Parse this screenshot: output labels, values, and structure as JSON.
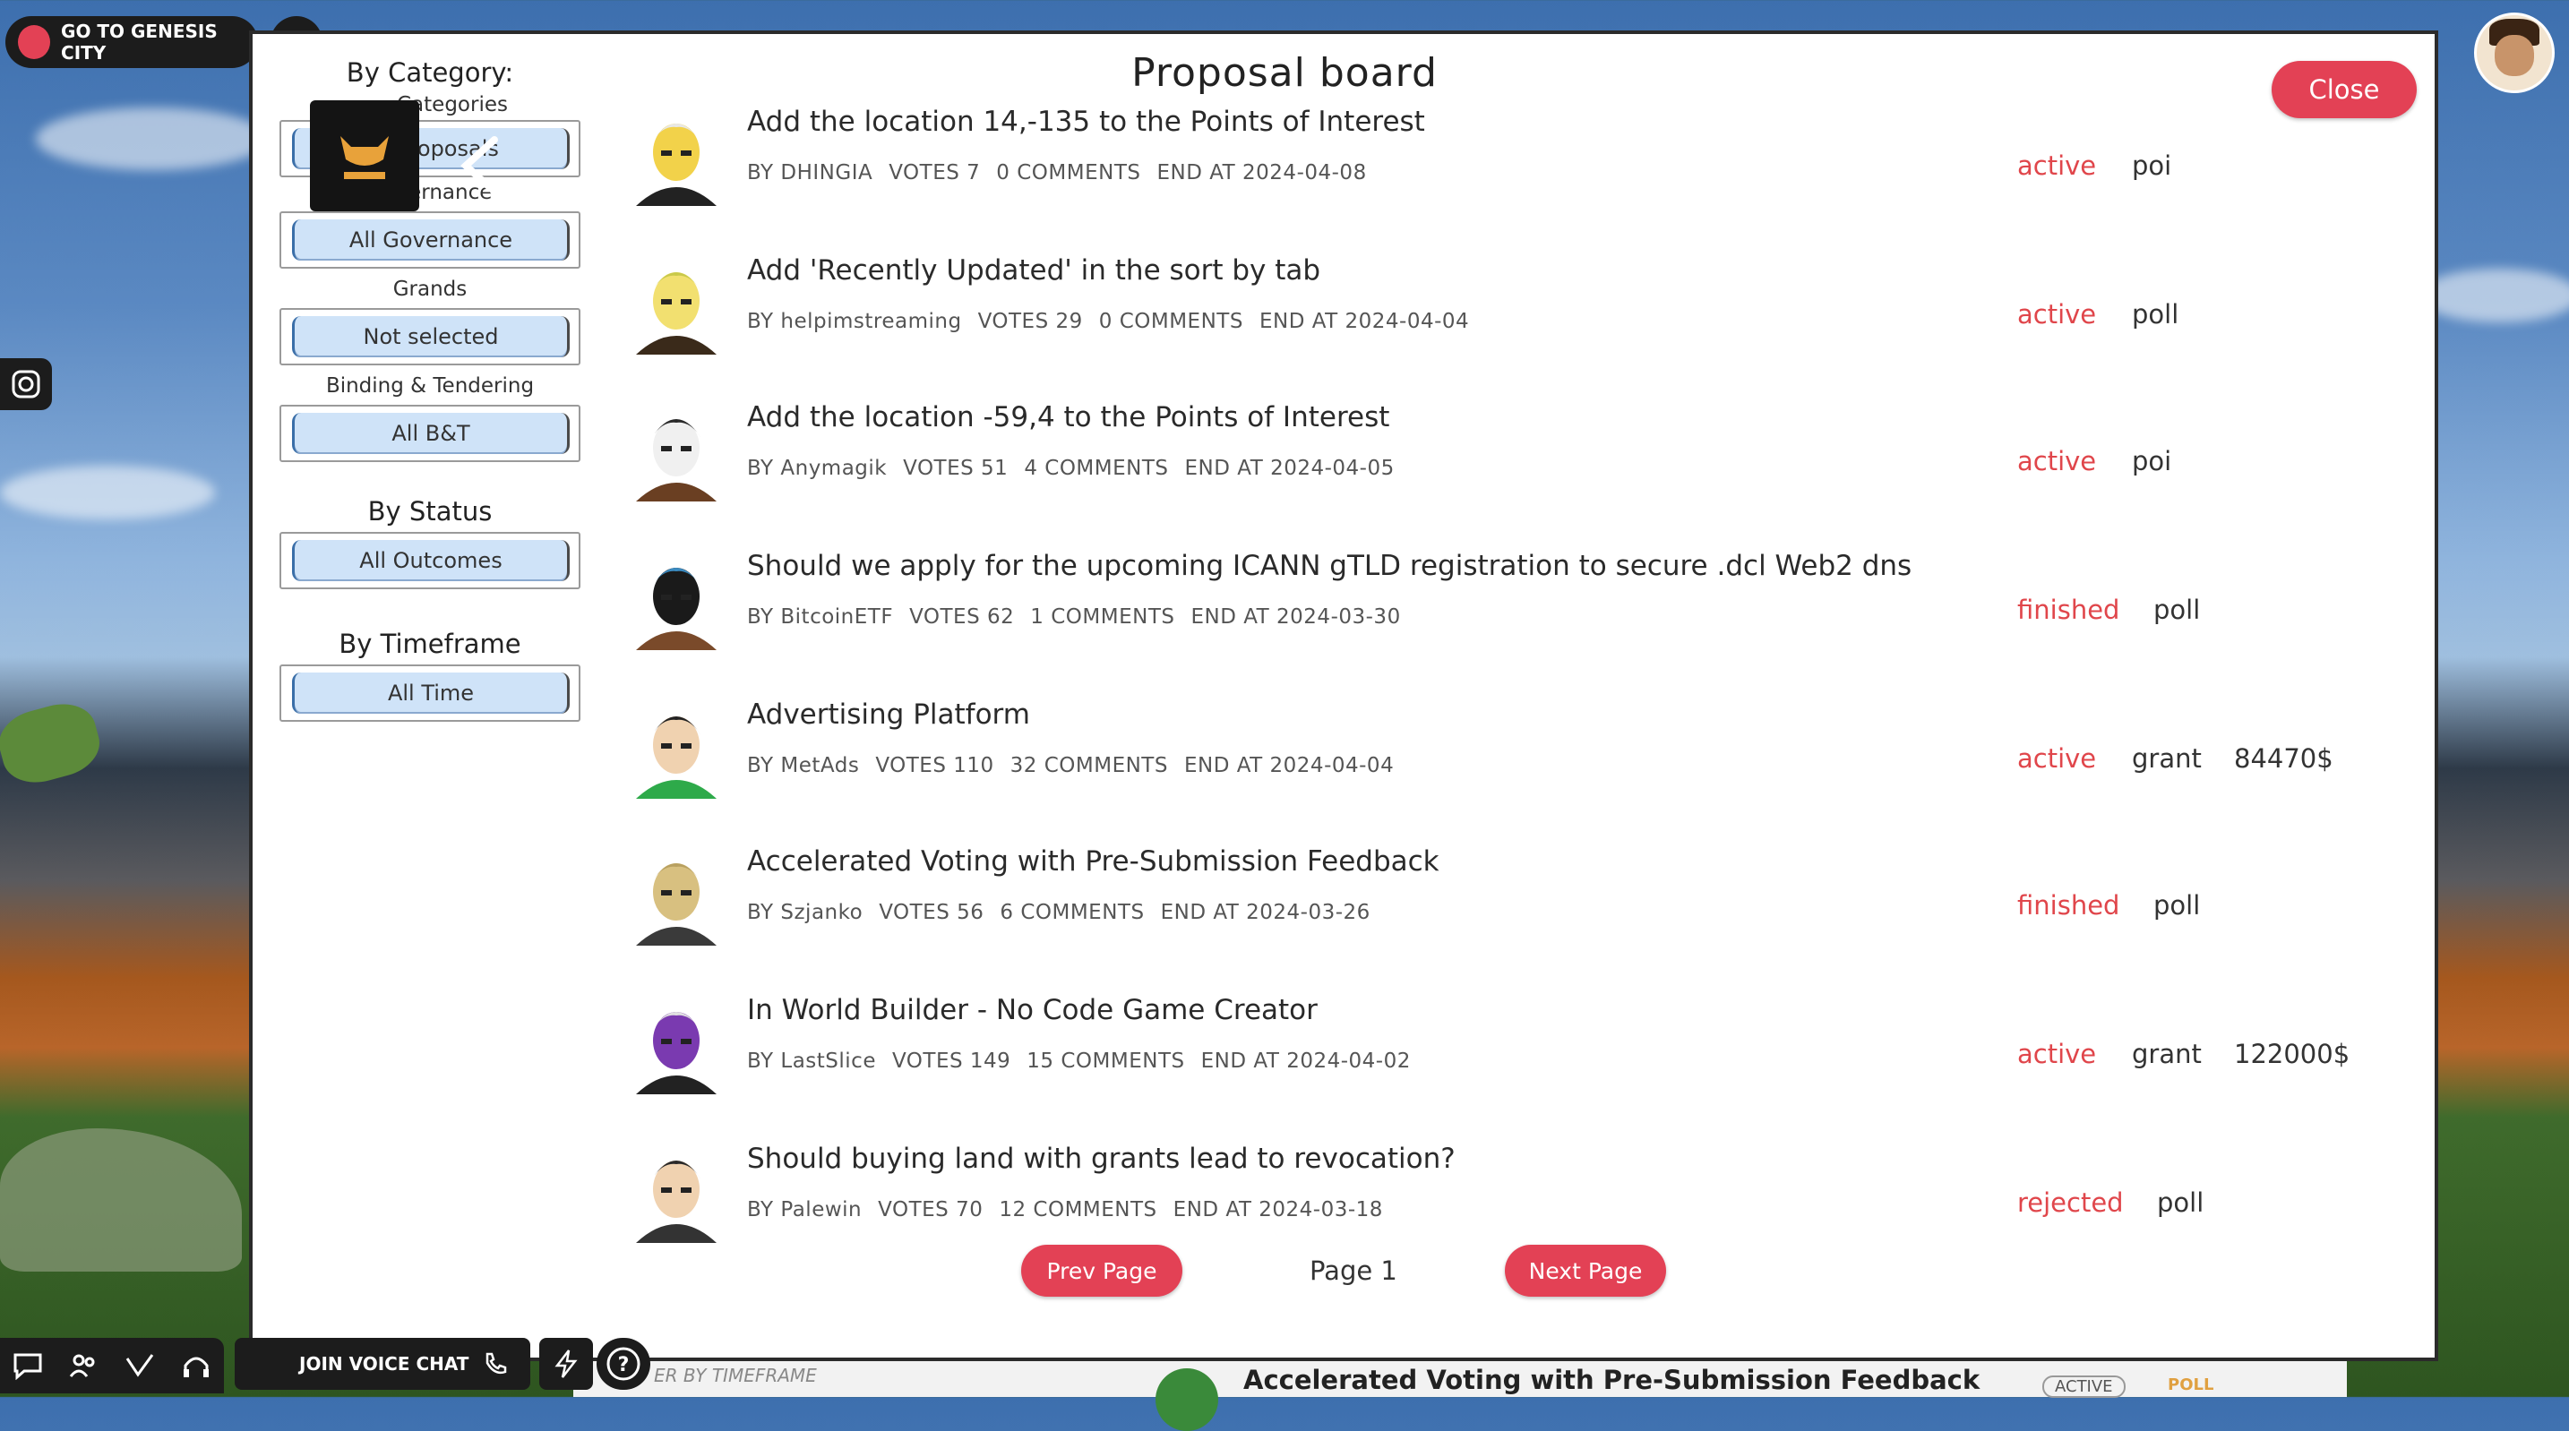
{
  "hud": {
    "genesis_label": "GO TO GENESIS CITY",
    "voice_label": "JOIN VOICE CHAT"
  },
  "panel": {
    "title": "Proposal board",
    "close_label": "Close"
  },
  "filters": {
    "category_heading": "By Category:",
    "categories_label": "Categories",
    "categories_value": "All Proposals",
    "governance_label": "Governance",
    "governance_value": "All Governance",
    "grands_label": "Grands",
    "grands_value": "Not selected",
    "bt_label": "Binding & Tendering",
    "bt_value": "All B&T",
    "status_heading": "By Status",
    "status_value": "All Outcomes",
    "timeframe_heading": "By Timeframe",
    "timeframe_value": "All Time"
  },
  "proposals": [
    {
      "title": "Add the location 14,-135 to the Points of Interest",
      "by": "BY DHINGIA",
      "votes": "VOTES 7",
      "comments": "0 COMMENTS",
      "end": "END AT 2024-04-08",
      "status": "active",
      "type": "poi",
      "amount": ""
    },
    {
      "title": "Add 'Recently Updated' in the sort by tab",
      "by": "BY helpimstreaming",
      "votes": "VOTES 29",
      "comments": "0 COMMENTS",
      "end": "END AT 2024-04-04",
      "status": "active",
      "type": "poll",
      "amount": ""
    },
    {
      "title": "Add the location -59,4 to the Points of Interest",
      "by": "BY Anymagik",
      "votes": "VOTES 51",
      "comments": "4 COMMENTS",
      "end": "END AT 2024-04-05",
      "status": "active",
      "type": "poi",
      "amount": ""
    },
    {
      "title": "Should we apply for the upcoming ICANN gTLD registration to secure .dcl Web2 dns",
      "by": "BY BitcoinETF",
      "votes": "VOTES 62",
      "comments": "1 COMMENTS",
      "end": "END AT 2024-03-30",
      "status": "finished",
      "type": "poll",
      "amount": ""
    },
    {
      "title": "Advertising Platform",
      "by": "BY MetAds",
      "votes": "VOTES 110",
      "comments": "32 COMMENTS",
      "end": "END AT 2024-04-04",
      "status": "active",
      "type": "grant",
      "amount": "84470$"
    },
    {
      "title": "Accelerated Voting with Pre-Submission Feedback",
      "by": "BY Szjanko",
      "votes": "VOTES 56",
      "comments": "6 COMMENTS",
      "end": "END AT 2024-03-26",
      "status": "finished",
      "type": "poll",
      "amount": ""
    },
    {
      "title": "In World Builder - No Code Game Creator",
      "by": "BY LastSlice",
      "votes": "VOTES 149",
      "comments": "15 COMMENTS",
      "end": "END AT 2024-04-02",
      "status": "active",
      "type": "grant",
      "amount": "122000$"
    },
    {
      "title": "Should buying land with grants lead to revocation?",
      "by": "BY Palewin",
      "votes": "VOTES 70",
      "comments": "12 COMMENTS",
      "end": "END AT 2024-03-18",
      "status": "rejected",
      "type": "poll",
      "amount": ""
    }
  ],
  "pager": {
    "prev_label": "Prev Page",
    "page_label": "Page 1",
    "next_label": "Next Page"
  },
  "background_strip": {
    "left_text": "ER BY TIMEFRAME",
    "title": "Accelerated Voting with Pre-Submission Feedback",
    "tag_active": "ACTIVE",
    "tag_poll": "POLL"
  },
  "colors": {
    "accent": "#e34155",
    "status_red": "#e0464b",
    "dropdown_fill": "#cfe3f8"
  }
}
